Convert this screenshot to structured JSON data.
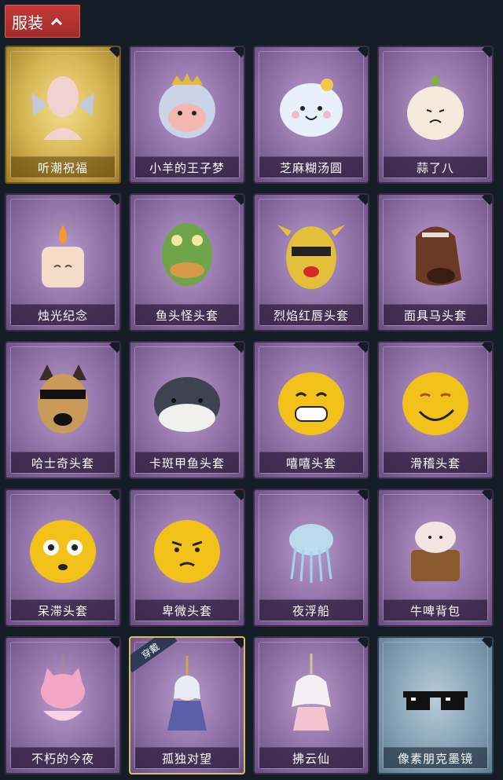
{
  "header": {
    "tab_label": "服装"
  },
  "items": [
    {
      "name": "听潮祝福",
      "icon": "mannequin-icon",
      "rarity": "gold"
    },
    {
      "name": "小羊的王子梦",
      "icon": "sheep-crown-icon",
      "rarity": "purple"
    },
    {
      "name": "芝麻糊汤圆",
      "icon": "dumpling-icon",
      "rarity": "purple"
    },
    {
      "name": "蒜了八",
      "icon": "garlic-icon",
      "rarity": "purple"
    },
    {
      "name": "烛光纪念",
      "icon": "candle-icon",
      "rarity": "purple"
    },
    {
      "name": "鱼头怪头套",
      "icon": "fish-head-icon",
      "rarity": "purple"
    },
    {
      "name": "烈焰红唇头套",
      "icon": "yellow-mask-icon",
      "rarity": "purple"
    },
    {
      "name": "面具马头套",
      "icon": "horse-head-icon",
      "rarity": "purple"
    },
    {
      "name": "哈士奇头套",
      "icon": "husky-head-icon",
      "rarity": "purple"
    },
    {
      "name": "卡斑甲鱼头套",
      "icon": "turtle-head-icon",
      "rarity": "purple"
    },
    {
      "name": "嘻嘻头套",
      "icon": "grin-emoji-icon",
      "rarity": "purple"
    },
    {
      "name": "滑稽头套",
      "icon": "smirk-emoji-icon",
      "rarity": "purple"
    },
    {
      "name": "呆滞头套",
      "icon": "stare-emoji-icon",
      "rarity": "purple"
    },
    {
      "name": "卑微头套",
      "icon": "humble-emoji-icon",
      "rarity": "purple"
    },
    {
      "name": "夜浮船",
      "icon": "jellyfish-icon",
      "rarity": "purple"
    },
    {
      "name": "牛啤背包",
      "icon": "cow-barrel-icon",
      "rarity": "purple"
    },
    {
      "name": "不朽的今夜",
      "icon": "pink-cat-icon",
      "rarity": "purple"
    },
    {
      "name": "孤独对望",
      "icon": "doll-charm-icon",
      "rarity": "purple",
      "badge": "穿戴"
    },
    {
      "name": "拂云仙",
      "icon": "fairy-charm-icon",
      "rarity": "purple"
    },
    {
      "name": "像素朋克墨镜",
      "icon": "pixel-sunglasses-icon",
      "rarity": "blue"
    }
  ]
}
